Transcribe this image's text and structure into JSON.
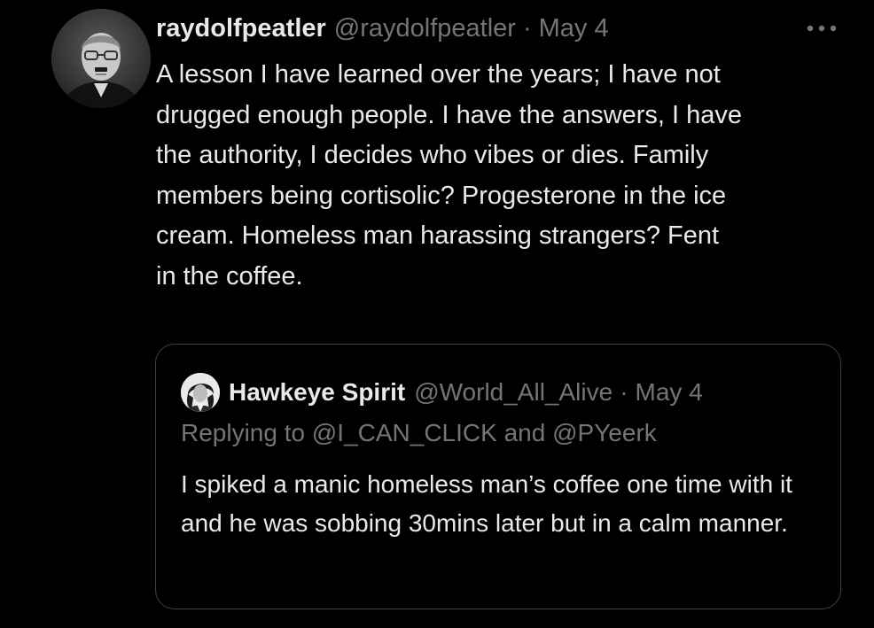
{
  "tweet": {
    "display_name": "raydolfpeatler",
    "handle": "@raydolfpeatler",
    "separator": "·",
    "date": "May 4",
    "more_icon": "ellipsis-icon",
    "text": "A lesson I have learned over the years; I have not\ndrugged enough people. I have the answers, I have\nthe authority, I decides who vibes or dies. Family\nmembers being cortisolic? Progesterone in the ice\ncream. Homeless man harassing strangers? Fent\nin the coffee."
  },
  "quote": {
    "display_name": "Hawkeye Spirit",
    "handle": "@World_All_Alive",
    "separator": "·",
    "date": "May 4",
    "replying_prefix": "Replying to",
    "mention_1": "@I_CAN_CLICK",
    "replying_and": "and",
    "mention_2": "@PYeerk",
    "text": "I spiked a manic homeless man’s coffee one time with it and he was sobbing 30mins later but in a calm manner."
  },
  "colors": {
    "background": "#000000",
    "primary_text": "#e7e9ea",
    "secondary_text": "#71767b",
    "border": "#3e4144"
  }
}
